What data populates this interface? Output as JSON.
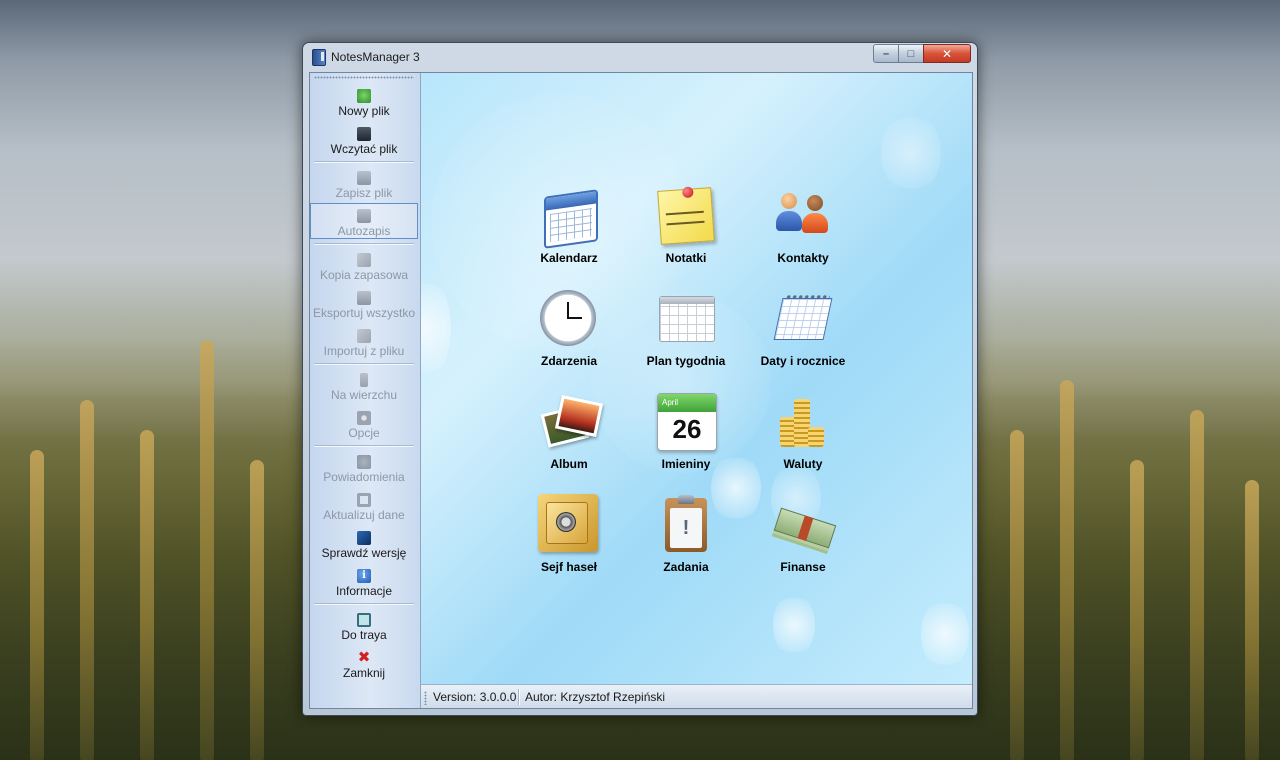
{
  "window": {
    "title": "NotesManager 3",
    "controls": {
      "minimize": "–",
      "maximize": "□",
      "close": "✕"
    }
  },
  "sidebar": {
    "items": [
      {
        "label": "Nowy plik",
        "icon": "new-file-icon",
        "enabled": true
      },
      {
        "label": "Wczytać plik",
        "icon": "open-file-icon",
        "enabled": true
      },
      {
        "label": "Zapisz plik",
        "icon": "save-icon",
        "enabled": false
      },
      {
        "label": "Autozapis",
        "icon": "autosave-icon",
        "enabled": false
      },
      {
        "label": "Kopia zapasowa",
        "icon": "backup-icon",
        "enabled": false
      },
      {
        "label": "Eksportuj wszystko",
        "icon": "export-icon",
        "enabled": false
      },
      {
        "label": "Importuj z pliku",
        "icon": "import-icon",
        "enabled": false
      },
      {
        "label": "Na wierzchu",
        "icon": "pin-icon",
        "enabled": false
      },
      {
        "label": "Opcje",
        "icon": "gear-icon",
        "enabled": false
      },
      {
        "label": "Powiadomienia",
        "icon": "bell-icon",
        "enabled": false
      },
      {
        "label": "Aktualizuj dane",
        "icon": "refresh-icon",
        "enabled": false
      },
      {
        "label": "Sprawdź wersję",
        "icon": "version-check-icon",
        "enabled": true
      },
      {
        "label": "Informacje",
        "icon": "info-icon",
        "enabled": true
      },
      {
        "label": "Do traya",
        "icon": "tray-icon",
        "enabled": true
      },
      {
        "label": "Zamknij",
        "icon": "close-red-x-icon",
        "enabled": true
      }
    ],
    "info_glyph": "i",
    "close_glyph": "✖"
  },
  "tiles": [
    {
      "label": "Kalendarz",
      "icon": "calendar-icon"
    },
    {
      "label": "Notatki",
      "icon": "sticky-note-icon"
    },
    {
      "label": "Kontakty",
      "icon": "contacts-icon"
    },
    {
      "label": "Zdarzenia",
      "icon": "clock-icon"
    },
    {
      "label": "Plan tygodnia",
      "icon": "week-plan-icon"
    },
    {
      "label": "Daty i rocznice",
      "icon": "desk-calendar-icon"
    },
    {
      "label": "Album",
      "icon": "photo-album-icon"
    },
    {
      "label": "Imieniny",
      "icon": "day-calendar-icon"
    },
    {
      "label": "Waluty",
      "icon": "coins-icon"
    },
    {
      "label": "Sejf haseł",
      "icon": "safe-icon"
    },
    {
      "label": "Zadania",
      "icon": "clipboard-icon"
    },
    {
      "label": "Finanse",
      "icon": "money-icon"
    }
  ],
  "day_calendar": {
    "month": "April",
    "day": "26"
  },
  "statusbar": {
    "version": "Version: 3.0.0.0",
    "author": "Autor: Krzysztof Rzepiński"
  },
  "colors": {
    "panel_light": "#d6f1fd",
    "panel_blue": "#9fdaf7",
    "close_red": "#d8533a"
  }
}
